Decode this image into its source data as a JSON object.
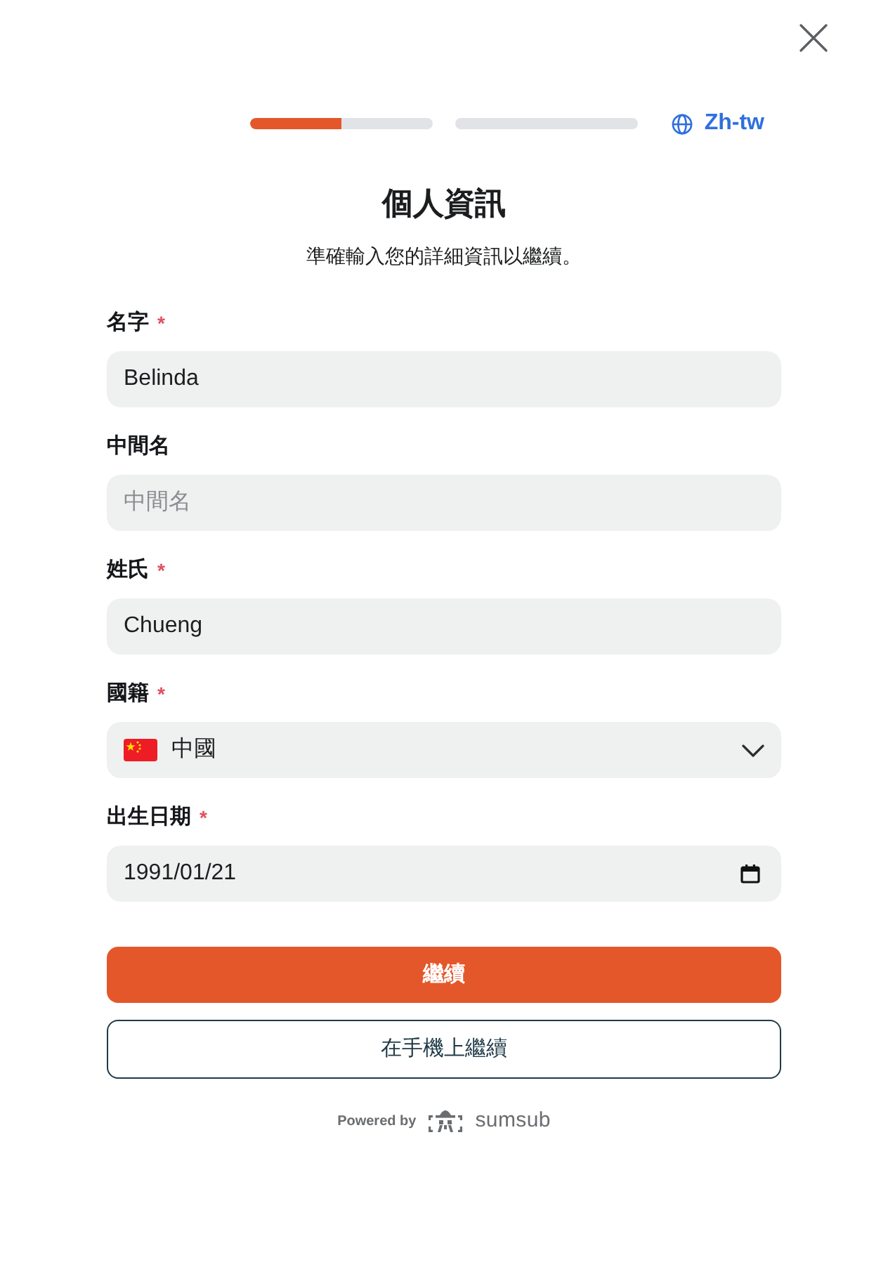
{
  "progress": {
    "level": 0.25
  },
  "language": {
    "label": "Zh-tw"
  },
  "heading": {
    "title": "個人資訊",
    "subtitle": "準確輸入您的詳細資訊以繼續。"
  },
  "form": {
    "required_mark": "*",
    "fields": [
      {
        "kind": "text",
        "label": "名字",
        "required": true,
        "value": "Belinda"
      },
      {
        "kind": "text",
        "label": "中間名",
        "required": false,
        "placeholder": "中間名"
      },
      {
        "kind": "text",
        "label": "姓氏",
        "required": true,
        "value": "Chueng"
      },
      {
        "kind": "select",
        "label": "國籍",
        "required": true,
        "value": "中國"
      },
      {
        "kind": "date",
        "label": "出生日期",
        "required": true,
        "value": "1991/01/21"
      }
    ]
  },
  "buttons": [
    {
      "kind": "primary",
      "label": "繼續"
    },
    {
      "kind": "outline",
      "label": "在手機上繼續"
    }
  ],
  "footer": {
    "powered_by": "Powered by",
    "brand": "sumsub"
  }
}
